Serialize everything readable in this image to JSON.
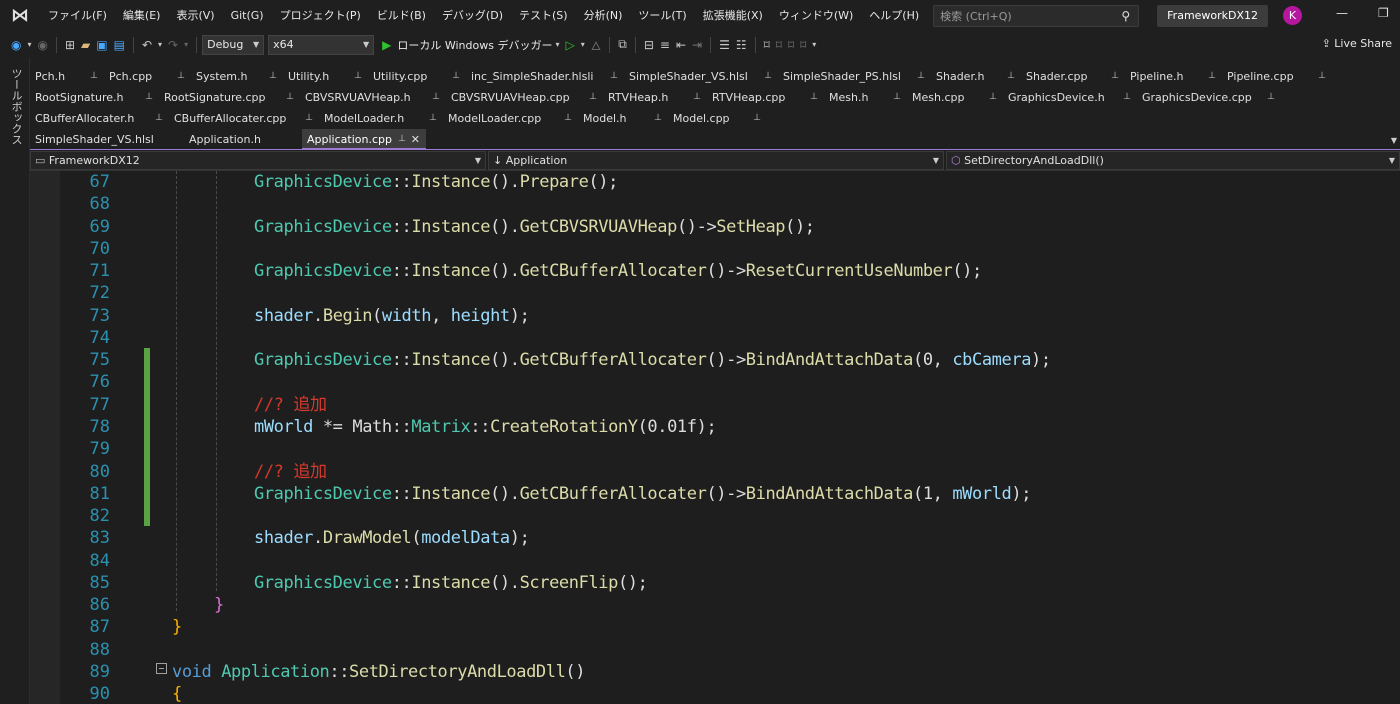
{
  "menubar": {
    "items": [
      "ファイル(F)",
      "編集(E)",
      "表示(V)",
      "Git(G)",
      "プロジェクト(P)",
      "ビルド(B)",
      "デバッグ(D)",
      "テスト(S)",
      "分析(N)",
      "ツール(T)",
      "拡張機能(X)",
      "ウィンドウ(W)",
      "ヘルプ(H)"
    ],
    "search_placeholder": "検索 (Ctrl+Q)",
    "solution_name": "FrameworkDX12",
    "avatar_initial": "K"
  },
  "toolbar": {
    "configuration": "Debug",
    "platform": "x64",
    "run_label": "ローカル Windows デバッガー",
    "liveshare_label": "Live Share"
  },
  "toolbox": {
    "label": "ツールボックス"
  },
  "tabs": {
    "row1": [
      "Pch.h",
      "Pch.cpp",
      "System.h",
      "Utility.h",
      "Utility.cpp",
      "inc_SimpleShader.hlsli",
      "SimpleShader_VS.hlsl",
      "SimpleShader_PS.hlsl",
      "Shader.h",
      "Shader.cpp",
      "Pipeline.h",
      "Pipeline.cpp"
    ],
    "row2": [
      "RootSignature.h",
      "RootSignature.cpp",
      "CBVSRVUAVHeap.h",
      "CBVSRVUAVHeap.cpp",
      "RTVHeap.h",
      "RTVHeap.cpp",
      "Mesh.h",
      "Mesh.cpp",
      "GraphicsDevice.h",
      "GraphicsDevice.cpp"
    ],
    "row3": [
      "CBufferAllocater.h",
      "CBufferAllocater.cpp",
      "ModelLoader.h",
      "ModelLoader.cpp",
      "Model.h",
      "Model.cpp"
    ],
    "row4": [
      "SimpleShader_VS.hlsl",
      "Application.h"
    ],
    "active": "Application.cpp"
  },
  "navbar": {
    "project": "FrameworkDX12",
    "scope": "Application",
    "member": "SetDirectoryAndLoadDll()"
  },
  "editor": {
    "lines": [
      {
        "n": "67",
        "code": [
          [
            "c-type",
            "GraphicsDevice"
          ],
          [
            "",
            "::"
          ],
          [
            "c-fn",
            "Instance"
          ],
          [
            "",
            "()."
          ],
          [
            "c-fn",
            "Prepare"
          ],
          [
            "",
            "();"
          ]
        ]
      },
      {
        "n": "68",
        "code": []
      },
      {
        "n": "69",
        "code": [
          [
            "c-type",
            "GraphicsDevice"
          ],
          [
            "",
            "::"
          ],
          [
            "c-fn",
            "Instance"
          ],
          [
            "",
            "()."
          ],
          [
            "c-fn",
            "GetCBVSRVUAVHeap"
          ],
          [
            "",
            "()->"
          ],
          [
            "c-fn",
            "SetHeap"
          ],
          [
            "",
            "();"
          ]
        ]
      },
      {
        "n": "70",
        "code": []
      },
      {
        "n": "71",
        "code": [
          [
            "c-type",
            "GraphicsDevice"
          ],
          [
            "",
            "::"
          ],
          [
            "c-fn",
            "Instance"
          ],
          [
            "",
            "()."
          ],
          [
            "c-fn",
            "GetCBufferAllocater"
          ],
          [
            "",
            "()->"
          ],
          [
            "c-fn",
            "ResetCurrentUseNumber"
          ],
          [
            "",
            "();"
          ]
        ]
      },
      {
        "n": "72",
        "code": []
      },
      {
        "n": "73",
        "code": [
          [
            "c-var",
            "shader"
          ],
          [
            "",
            "."
          ],
          [
            "c-fn",
            "Begin"
          ],
          [
            "",
            "("
          ],
          [
            "c-var",
            "width"
          ],
          [
            "",
            ", "
          ],
          [
            "c-var",
            "height"
          ],
          [
            "",
            ");"
          ]
        ]
      },
      {
        "n": "74",
        "code": []
      },
      {
        "n": "75",
        "code": [
          [
            "c-type",
            "GraphicsDevice"
          ],
          [
            "",
            "::"
          ],
          [
            "c-fn",
            "Instance"
          ],
          [
            "",
            "()."
          ],
          [
            "c-fn",
            "GetCBufferAllocater"
          ],
          [
            "",
            "()->"
          ],
          [
            "c-fn",
            "BindAndAttachData"
          ],
          [
            "",
            "(0, "
          ],
          [
            "c-var",
            "cbCamera"
          ],
          [
            "",
            ");"
          ]
        ]
      },
      {
        "n": "76",
        "code": []
      },
      {
        "n": "77",
        "code": [
          [
            "c-cmt",
            "//? 追加"
          ]
        ]
      },
      {
        "n": "78",
        "code": [
          [
            "c-var",
            "mWorld"
          ],
          [
            "",
            " *= Math::"
          ],
          [
            "c-type",
            "Matrix"
          ],
          [
            "",
            "::"
          ],
          [
            "c-fn",
            "CreateRotationY"
          ],
          [
            "",
            "(0.01f);"
          ]
        ]
      },
      {
        "n": "79",
        "code": []
      },
      {
        "n": "80",
        "code": [
          [
            "c-cmt",
            "//? 追加"
          ]
        ]
      },
      {
        "n": "81",
        "code": [
          [
            "c-type",
            "GraphicsDevice"
          ],
          [
            "",
            "::"
          ],
          [
            "c-fn",
            "Instance"
          ],
          [
            "",
            "()."
          ],
          [
            "c-fn",
            "GetCBufferAllocater"
          ],
          [
            "",
            "()->"
          ],
          [
            "c-fn",
            "BindAndAttachData"
          ],
          [
            "",
            "(1, "
          ],
          [
            "c-var",
            "mWorld"
          ],
          [
            "",
            ");"
          ]
        ]
      },
      {
        "n": "82",
        "code": []
      },
      {
        "n": "83",
        "code": [
          [
            "c-var",
            "shader"
          ],
          [
            "",
            "."
          ],
          [
            "c-fn",
            "DrawModel"
          ],
          [
            "",
            "("
          ],
          [
            "c-var",
            "modelData"
          ],
          [
            "",
            ");"
          ]
        ]
      },
      {
        "n": "84",
        "code": []
      },
      {
        "n": "85",
        "code": [
          [
            "c-type",
            "GraphicsDevice"
          ],
          [
            "",
            "::"
          ],
          [
            "c-fn",
            "Instance"
          ],
          [
            "",
            "()."
          ],
          [
            "c-fn",
            "ScreenFlip"
          ],
          [
            "",
            "();"
          ]
        ]
      },
      {
        "n": "86",
        "code": [
          [
            "c-brace-m",
            "}"
          ]
        ]
      },
      {
        "n": "87",
        "code": [
          [
            "c-brace-o",
            "}"
          ]
        ]
      },
      {
        "n": "88",
        "code": []
      },
      {
        "n": "89",
        "code": [
          [
            "c-kw",
            "void "
          ],
          [
            "c-type",
            "Application"
          ],
          [
            "",
            "::"
          ],
          [
            "c-fn",
            "SetDirectoryAndLoadDll"
          ],
          [
            "",
            "()"
          ]
        ]
      },
      {
        "n": "90",
        "code": [
          [
            "c-brace-o",
            "{"
          ]
        ]
      }
    ]
  }
}
